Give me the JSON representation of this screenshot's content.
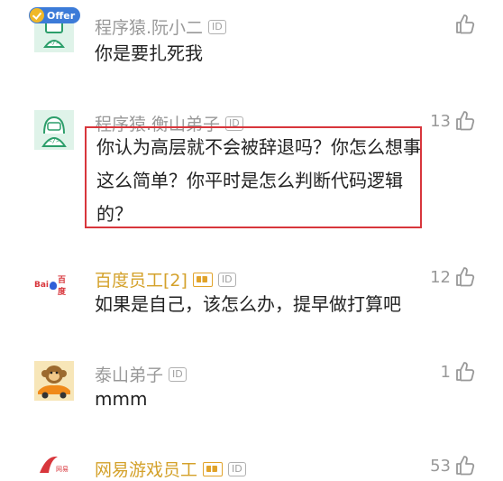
{
  "comments": [
    {
      "username": "程序猿.阮小二",
      "badge": "Offer",
      "id_badge": "ID",
      "text": "你是要扎死我",
      "likes": ""
    },
    {
      "username": "程序猿.衡山弟子",
      "id_badge": "ID",
      "text": "你认为高层就不会被辞退吗？你怎么想事这么简单？你平时是怎么判断代码逻辑的？",
      "likes": "13"
    },
    {
      "username": "百度员工[2]",
      "id_badge": "ID",
      "avatar_text": "Bai百度",
      "text": "如果是自己，该怎么办，提早做打算吧",
      "likes": "12"
    },
    {
      "username": "泰山弟子",
      "id_badge": "ID",
      "text": "mmm",
      "likes": "1"
    },
    {
      "username": "网易游戏员工",
      "id_badge": "ID",
      "text": "",
      "likes": "53"
    }
  ],
  "colors": {
    "highlight": "#d8363c",
    "gold_name": "#d4a12a",
    "gray_name": "#999999",
    "text": "#222222"
  }
}
